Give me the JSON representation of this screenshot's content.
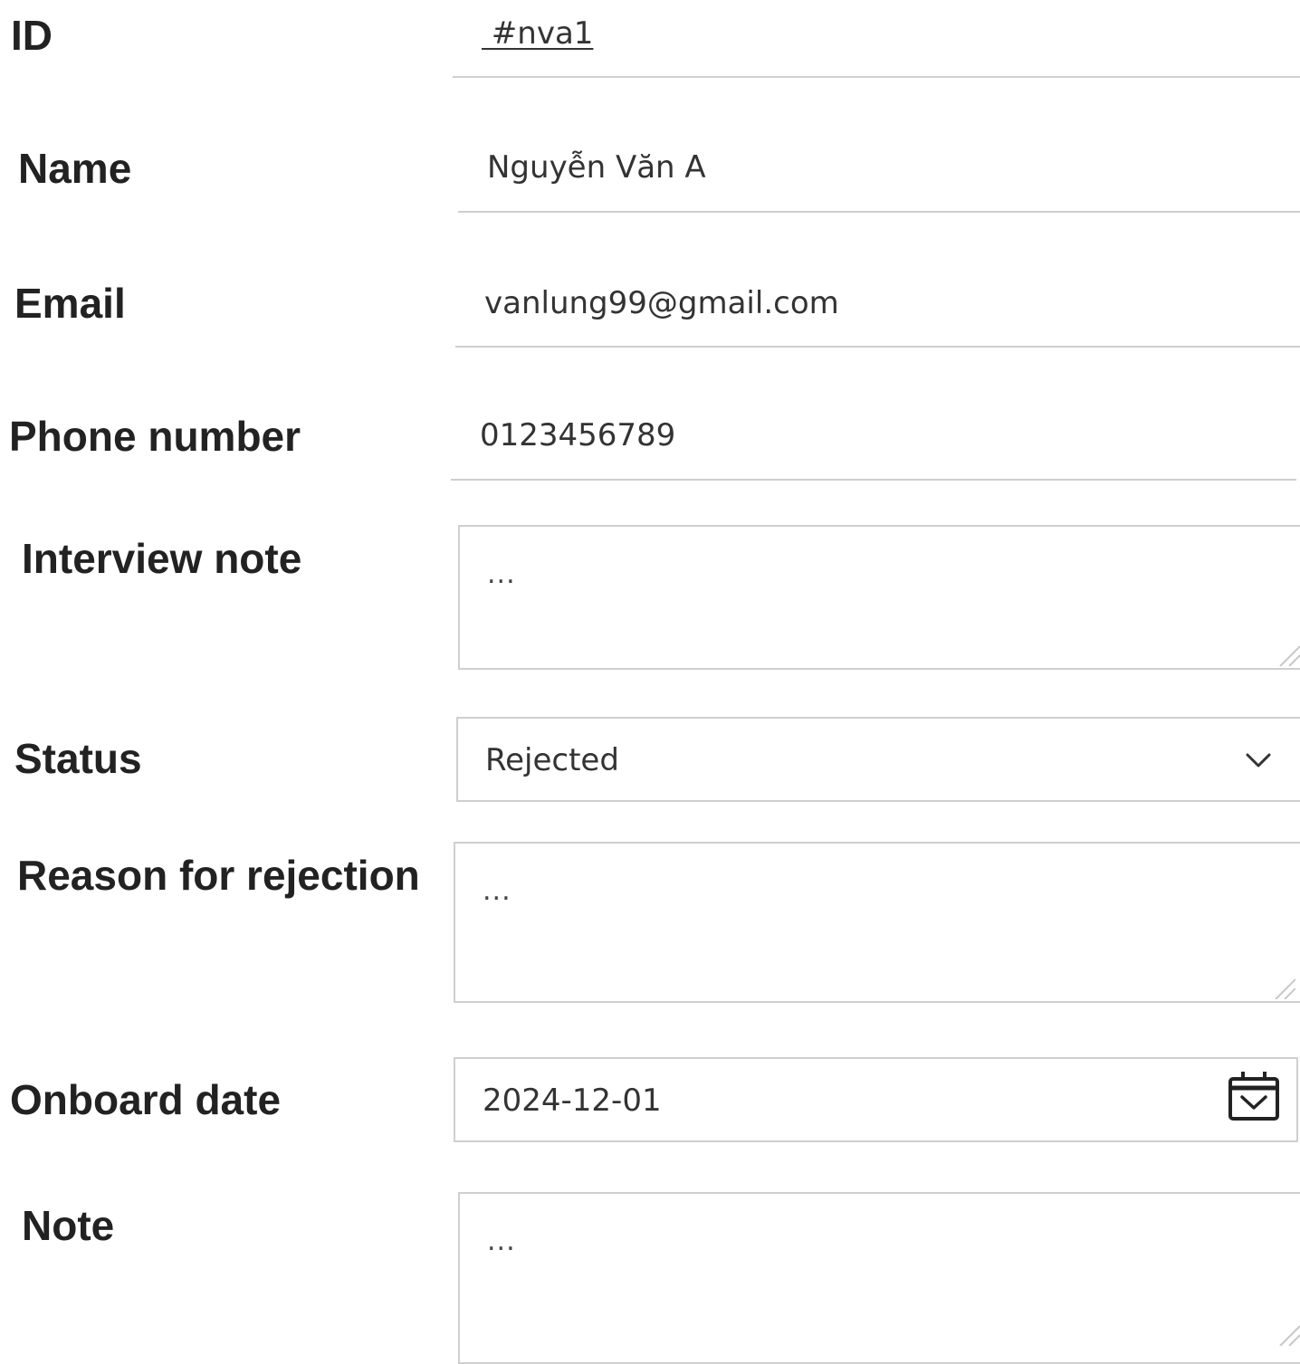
{
  "fields": {
    "id": {
      "label": "ID",
      "value": " #nva1"
    },
    "name": {
      "label": "Name",
      "value": "Nguyễn Văn A"
    },
    "email": {
      "label": "Email",
      "value": "vanlung99@gmail.com"
    },
    "phone": {
      "label": "Phone number",
      "value": "0123456789"
    },
    "interview_note": {
      "label": "Interview note",
      "value": "..."
    },
    "status": {
      "label": "Status",
      "value": "Rejected"
    },
    "reason": {
      "label": "Reason for rejection",
      "value": "..."
    },
    "onboard_date": {
      "label": "Onboard date",
      "value": "2024-12-01"
    },
    "note": {
      "label": "Note",
      "value": "..."
    }
  },
  "icons": {
    "status_dropdown": "chevron-down-icon",
    "date_picker": "calendar-icon",
    "textarea_resize": "resize-handle-icon"
  },
  "colors": {
    "label": "#222222",
    "value": "#333333",
    "border": "#cfcfcf"
  }
}
